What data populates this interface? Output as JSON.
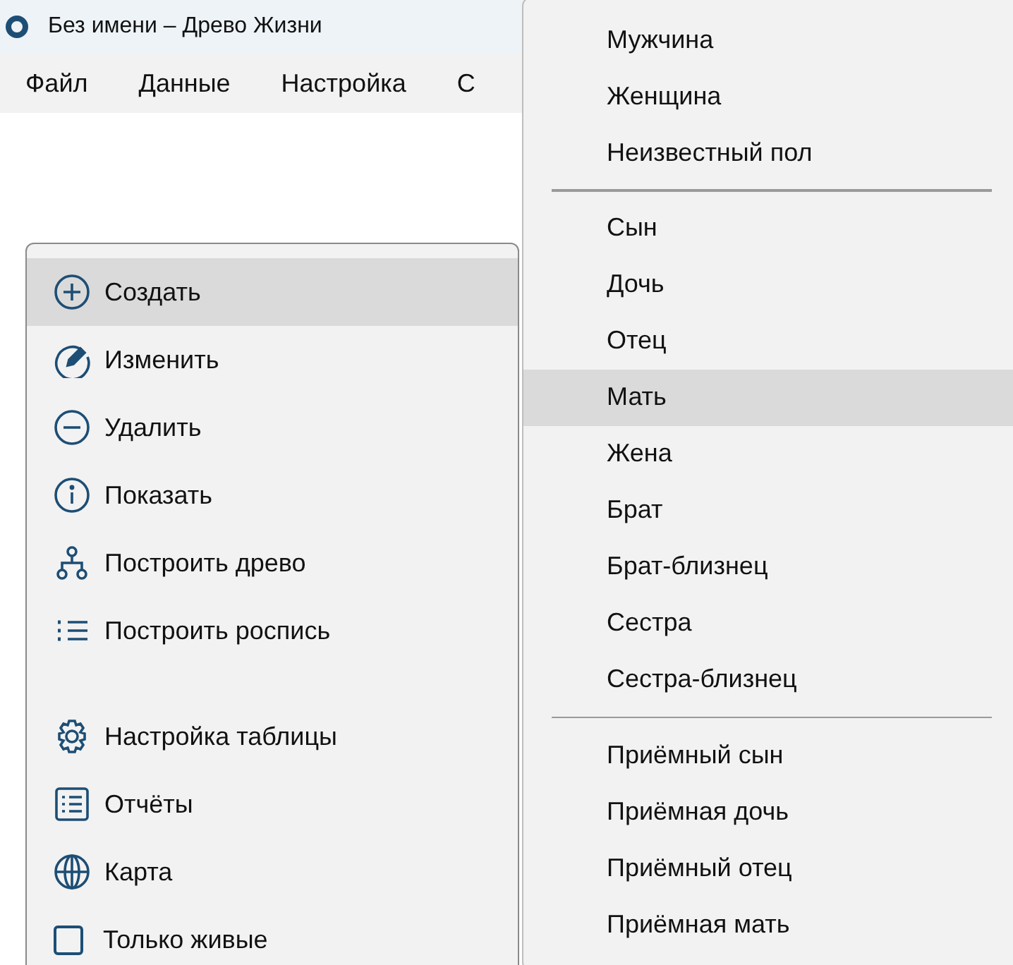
{
  "window": {
    "title": "Без имени – Древо Жизни"
  },
  "menu_bar": [
    {
      "label": "Файл"
    },
    {
      "label": "Данные"
    },
    {
      "label": "Настройка"
    },
    {
      "label": "С"
    }
  ],
  "context_menu": {
    "items": [
      {
        "kind": "command",
        "label": "Создать",
        "selected": true
      },
      {
        "kind": "command",
        "label": "Изменить",
        "selected": false
      },
      {
        "kind": "command",
        "label": "Удалить",
        "selected": false
      },
      {
        "kind": "command",
        "label": "Показать",
        "selected": false
      },
      {
        "kind": "command",
        "label": "Построить древо",
        "selected": false
      },
      {
        "kind": "command",
        "label": "Построить роспись",
        "selected": false
      },
      {
        "kind": "spacer"
      },
      {
        "kind": "command",
        "label": "Настройка таблицы",
        "selected": false
      },
      {
        "kind": "command",
        "label": "Отчёты",
        "selected": false
      },
      {
        "kind": "command",
        "label": "Карта",
        "selected": false
      },
      {
        "kind": "checkbox",
        "label": "Только живые",
        "checked": false,
        "selected": false
      }
    ]
  },
  "submenu": {
    "groups": [
      [
        {
          "label": "Мужчина",
          "selected": false
        },
        {
          "label": "Женщина",
          "selected": false
        },
        {
          "label": "Неизвестный пол",
          "selected": false
        }
      ],
      [
        {
          "label": "Сын",
          "selected": false
        },
        {
          "label": "Дочь",
          "selected": false
        },
        {
          "label": "Отец",
          "selected": false
        },
        {
          "label": "Мать",
          "selected": true
        },
        {
          "label": "Жена",
          "selected": false
        },
        {
          "label": "Брат",
          "selected": false
        },
        {
          "label": "Брат-близнец",
          "selected": false
        },
        {
          "label": "Сестра",
          "selected": false
        },
        {
          "label": "Сестра-близнец",
          "selected": false
        }
      ],
      [
        {
          "label": "Приёмный сын",
          "selected": false
        },
        {
          "label": "Приёмная дочь",
          "selected": false
        },
        {
          "label": "Приёмный отец",
          "selected": false
        },
        {
          "label": "Приёмная мать",
          "selected": false
        }
      ]
    ]
  }
}
